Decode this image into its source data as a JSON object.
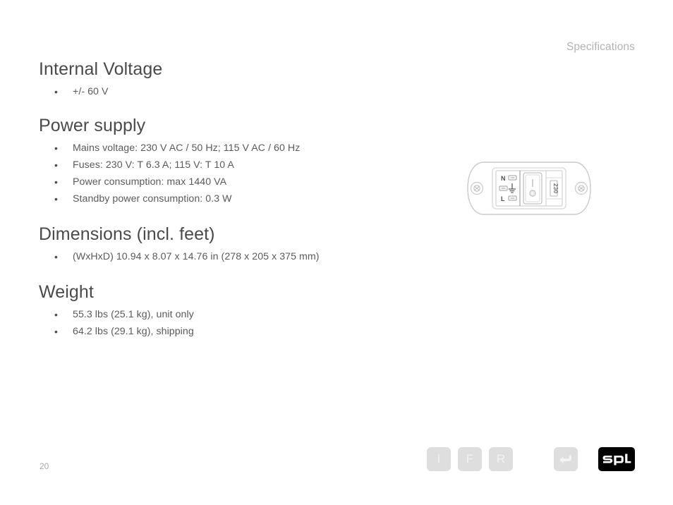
{
  "header": {
    "title": "Specifications"
  },
  "sections": [
    {
      "id": "internal-voltage",
      "title": "Internal Voltage",
      "items": [
        "+/- 60 V"
      ]
    },
    {
      "id": "power-supply",
      "title": "Power supply",
      "items": [
        "Mains voltage: 230 V AC / 50 Hz; 115 V AC / 60 Hz",
        "Fuses: 230 V: T 6.3 A; 115 V: T 10 A",
        "Power consumption: max 1440 VA",
        "Standby power consumption: 0.3 W"
      ]
    },
    {
      "id": "dimensions",
      "title": "Dimensions (incl. feet)",
      "items": [
        "(WxHxD) 10.94 x 8.07 x 14.76 in (278 x 205 x 375 mm)"
      ]
    },
    {
      "id": "weight",
      "title": "Weight",
      "items": [
        "55.3 lbs (25.1 kg), unit only",
        "64.2 lbs (29.1 kg), shipping"
      ]
    }
  ],
  "bullet_glyph": "•",
  "illustration": {
    "name": "iec-power-inlet-module",
    "labels": {
      "neutral": "N",
      "line": "L",
      "earth_symbol": "earth-ground-symbol",
      "voltage_selector": "230",
      "switch_on": "I",
      "switch_off": "O"
    }
  },
  "footer": {
    "page_number": "20",
    "nav_buttons": [
      {
        "name": "index-button",
        "label": "I"
      },
      {
        "name": "forward-button",
        "label": "F"
      },
      {
        "name": "rewind-button",
        "label": "R"
      }
    ],
    "back_button": {
      "name": "back-button",
      "icon": "return-arrow-icon"
    },
    "brand": {
      "name": "spl-logo",
      "text": "spl"
    }
  },
  "colors": {
    "heading": "#4a4a4a",
    "body": "#5a5a5a",
    "muted": "#b2b2b2",
    "nav_button_bg": "#dededf",
    "nav_button_fg": "#f2f2f2",
    "logo_bg": "#000000",
    "illustration_line": "#cfcfcf"
  }
}
